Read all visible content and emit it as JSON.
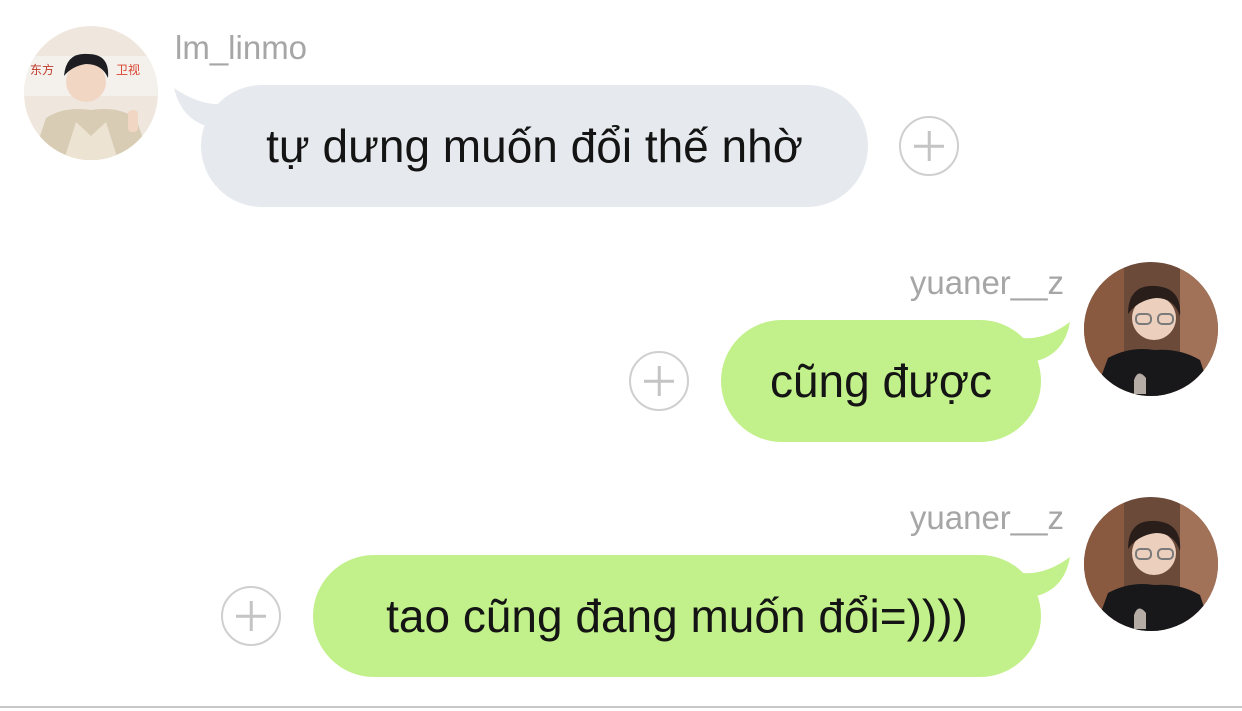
{
  "messages": [
    {
      "sender": "lm_linmo",
      "direction": "incoming",
      "text": "tự dưng muốn đổi thế nhờ",
      "avatar_icon": "user-avatar-photo"
    },
    {
      "sender": "yuaner__z",
      "direction": "outgoing",
      "text": "cũng được",
      "avatar_icon": "user-avatar-photo"
    },
    {
      "sender": "yuaner__z",
      "direction": "outgoing",
      "text": "tao cũng đang muốn đổi=))))",
      "avatar_icon": "user-avatar-photo"
    }
  ],
  "react_icon": "add-reaction-plus-icon",
  "colors": {
    "incoming_bubble": "#e6eaee",
    "outgoing_bubble": "#c2f08a",
    "username": "#a6a6a6",
    "text": "#141414",
    "react_border": "#cfcfcf"
  }
}
